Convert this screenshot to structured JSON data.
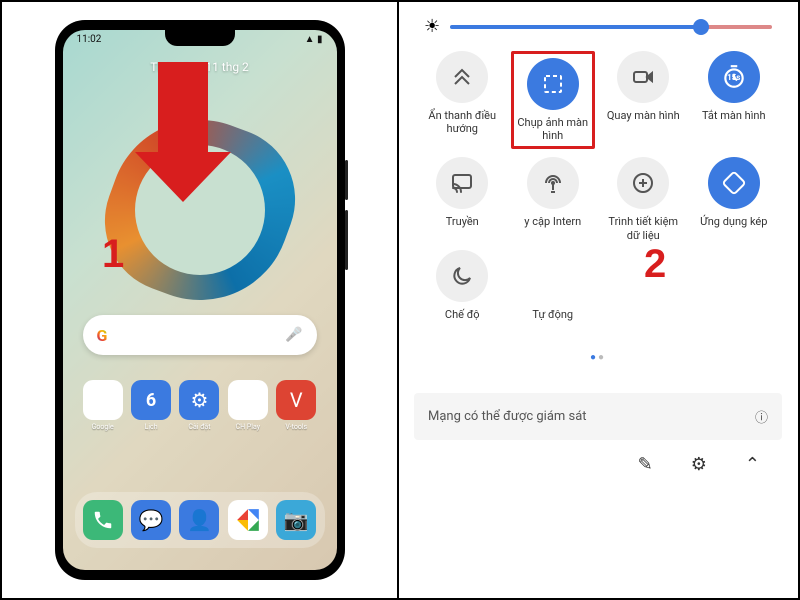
{
  "annotations": {
    "step1": "1",
    "step2": "2"
  },
  "phone": {
    "time": "11:02",
    "date": "Thứ Năm, 11 thg 2",
    "apps_row1": [
      {
        "name": "google-folder",
        "label": "Google"
      },
      {
        "name": "calendar",
        "label": "Lịch",
        "badge": "6"
      },
      {
        "name": "settings",
        "label": "Cài đặt"
      },
      {
        "name": "play-store",
        "label": "CH Play"
      },
      {
        "name": "v-tools",
        "label": "V-tools"
      }
    ],
    "dock": [
      {
        "name": "phone",
        "label": ""
      },
      {
        "name": "messages",
        "label": ""
      },
      {
        "name": "contacts",
        "label": ""
      },
      {
        "name": "photos",
        "label": ""
      },
      {
        "name": "camera",
        "label": ""
      }
    ]
  },
  "quick_settings": {
    "brightness_percent": 78,
    "tiles": [
      {
        "id": "nav-bar",
        "label": "Ẩn thanh điều hướng",
        "active": false,
        "icon": "nav"
      },
      {
        "id": "screenshot",
        "label": "Chụp ảnh màn hình",
        "active": true,
        "icon": "capture",
        "highlighted": true
      },
      {
        "id": "screen-record",
        "label": "Quay màn hình",
        "active": false,
        "icon": "record"
      },
      {
        "id": "screen-off",
        "label": "Tắt màn hình",
        "active": true,
        "icon": "timer"
      },
      {
        "id": "cast",
        "label": "Truyền",
        "active": false,
        "icon": "cast"
      },
      {
        "id": "internet-access",
        "label": "y cập Intern",
        "active": false,
        "icon": "wifi-usb"
      },
      {
        "id": "data-saver",
        "label": "Trình tiết kiệm dữ liệu",
        "active": false,
        "icon": "data"
      },
      {
        "id": "dual-app",
        "label": "Ứng dụng kép",
        "active": true,
        "icon": "dual"
      },
      {
        "id": "dark-mode",
        "label": "Chế độ",
        "active": false,
        "icon": "moon"
      },
      {
        "id": "auto",
        "label": "Tự động",
        "active": false,
        "icon": "blank"
      }
    ],
    "network_notice": "Mạng có thể được giám sát"
  }
}
